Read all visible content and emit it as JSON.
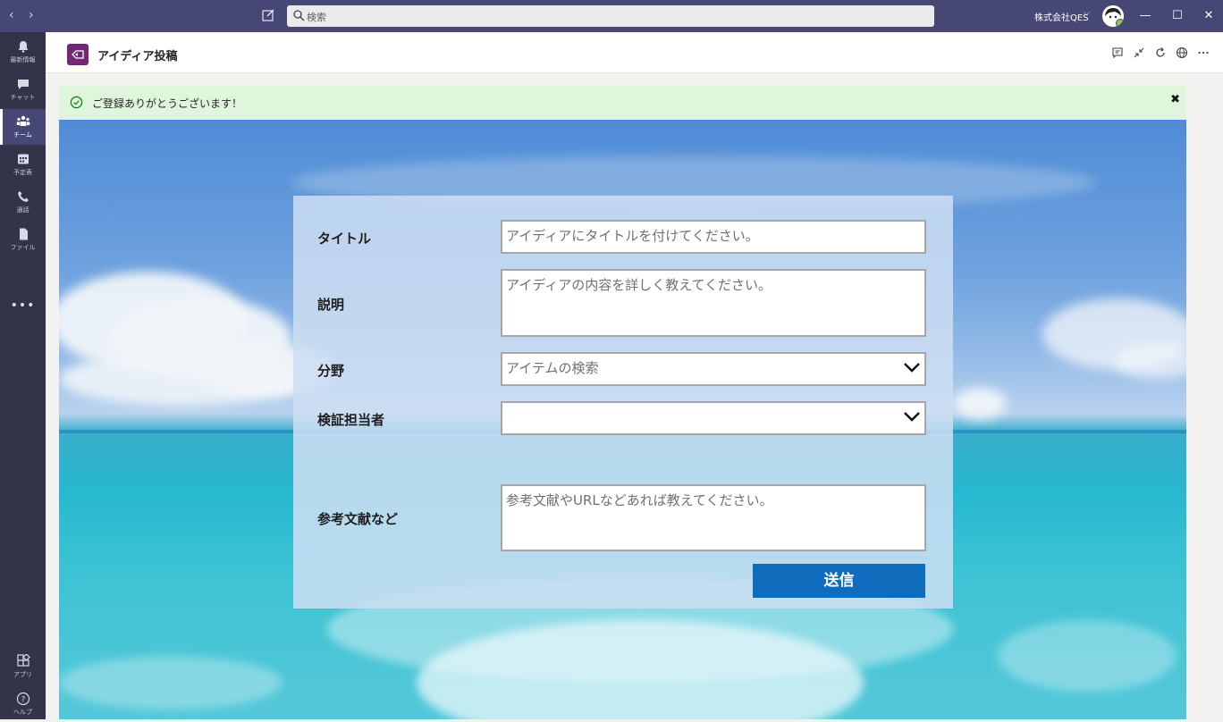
{
  "window": {
    "search_placeholder": "検索",
    "org_name": "株式会社QES",
    "colors": {
      "titlebar": "#464775",
      "rail": "#33344a",
      "accent": "#0f6cbd",
      "success_bg": "#dff6dd"
    }
  },
  "rail": {
    "items": [
      {
        "label": "最新情報",
        "icon": "bell-icon"
      },
      {
        "label": "チャット",
        "icon": "chat-icon"
      },
      {
        "label": "チーム",
        "icon": "teams-icon",
        "active": true
      },
      {
        "label": "予定表",
        "icon": "calendar-icon"
      },
      {
        "label": "通話",
        "icon": "phone-icon"
      },
      {
        "label": "ファイル",
        "icon": "file-icon"
      }
    ],
    "more": "•••",
    "bottom": [
      {
        "label": "アプリ",
        "icon": "apps-icon"
      },
      {
        "label": "ヘルプ",
        "icon": "help-icon"
      }
    ]
  },
  "app": {
    "title": "アイディア投稿"
  },
  "banner": {
    "message": "ご登録ありがとうございます！",
    "close": "✖"
  },
  "form": {
    "title_label": "タイトル",
    "title_placeholder": "アイディアにタイトルを付けてください。",
    "description_label": "説明",
    "description_placeholder": "アイディアの内容を詳しく教えてください。",
    "category_label": "分野",
    "category_placeholder": "アイテムの検索",
    "reviewer_label": "検証担当者",
    "reviewer_value": "",
    "reference_label": "参考文献など",
    "reference_placeholder": "参考文献やURLなどあれば教えてください。",
    "submit_label": "送信"
  }
}
